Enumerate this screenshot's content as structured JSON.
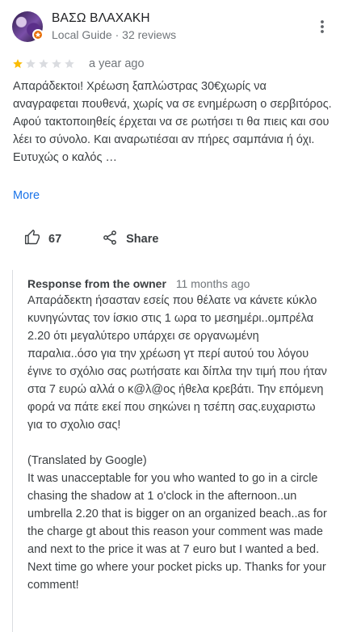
{
  "reviewer": {
    "name": "ΒΑΣΩ ΒΛΑΧΑΚΗ",
    "meta": "Local Guide · 32 reviews"
  },
  "rating": {
    "stars": 1,
    "max": 5,
    "filled_color": "#fbbc04",
    "empty_color": "#dadce0"
  },
  "date": "a year ago",
  "review_text": "Απαράδεκτοι! Χρέωση ξαπλώστρας 30€χωρίς να αναγραφεται πουθενά, χωρίς να σε ενημέρωση ο σερβιτόρος. Αφού τακτοποιηθείς έρχεται να σε ρωτήσει τι θα πιεις και σου λέει το σύνολο. Και αναρωτιέσαι αν πήρες σαμπάνια ή όχι. Ευτυχώς ο καλός …",
  "more_label": "More",
  "actions": {
    "like_count": "67",
    "share_label": "Share"
  },
  "response": {
    "header": "Response from the owner",
    "date": "11 months ago",
    "text": "Απαράδεκτη  ήσασταν  εσείς που θέλατε  να κάνετε κύκλο κυνηγώντας  τον ίσκιο στις 1 ωρα το μεσημέρι..ομπρέλα 2.20 ότι μεγαλύτερο  υπάρχει σε οργανωμένη  παραλια..όσο για την χρέωση γτ περί αυτού του λόγου έγινε το σχόλιο σας ρωτήσατε και δίπλα την τιμή που ήταν στα 7 ευρώ αλλά ο κ@λ@ος ήθελα κρεβάτι. Την επόμενη φορά να πάτε εκεί που σηκώνει η τσέπη σας.ευχαριστω για το σχολιο σας!\n\n(Translated by Google)\nIt was unacceptable for you who wanted to go in a circle chasing the shadow at 1 o'clock in the afternoon..un umbrella 2.20 that is bigger on an organized beach..as for the charge gt about this reason your comment was made and next to the price it was at 7 euro but I wanted a bed. Next time go where your pocket picks up. Thanks for your comment!"
  },
  "icons": {
    "badge": "local-guide-star-icon",
    "menu": "more-vert-icon",
    "like": "thumb-up-icon",
    "share": "share-icon"
  },
  "colors": {
    "accent": "#1a73e8",
    "badge": "#e8710a"
  }
}
